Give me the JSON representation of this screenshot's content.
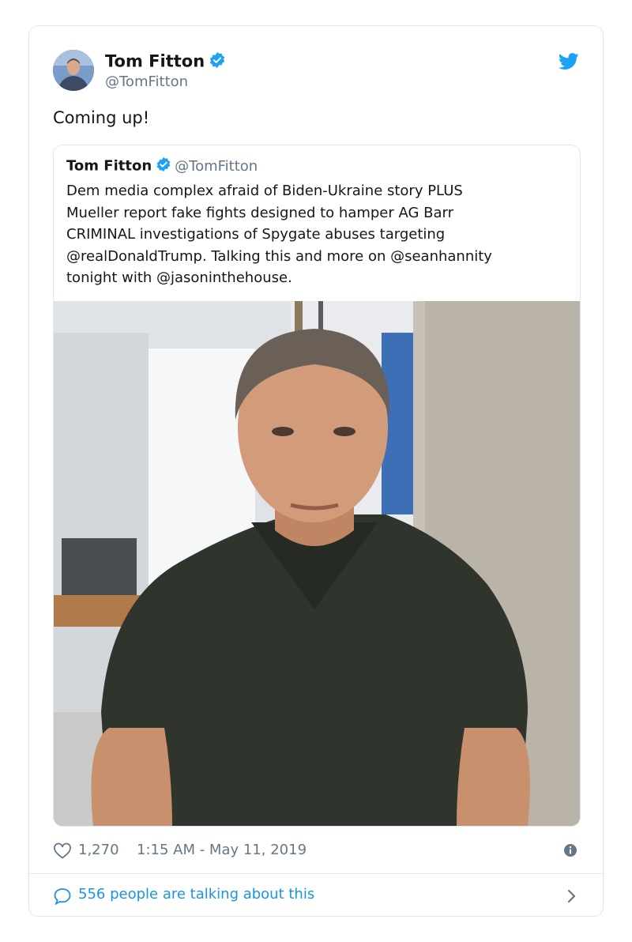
{
  "author": {
    "name": "Tom Fitton",
    "handle": "@TomFitton"
  },
  "tweet": {
    "text": "Coming up!"
  },
  "quoted": {
    "name": "Tom Fitton",
    "handle": "@TomFitton",
    "lines": [
      "Dem media complex afraid of Biden-Ukraine story PLUS",
      "Mueller report fake fights designed to hamper AG Barr",
      "CRIMINAL investigations of Spygate abuses targeting",
      "@realDonaldTrump. Talking this and more on @seanhannity",
      "tonight with @jasoninthehouse."
    ]
  },
  "meta": {
    "likes": "1,270",
    "timestamp": "1:15 AM - May 11, 2019"
  },
  "conversation": {
    "label": "556 people are talking about this"
  },
  "colors": {
    "accent": "#1da1f2",
    "link": "#1b95e0",
    "muted": "#657786",
    "border": "#e1e8ed"
  },
  "icons": [
    "verified-icon",
    "twitter-bird-icon",
    "heart-icon",
    "info-icon",
    "speech-bubble-icon",
    "chevron-right-icon"
  ]
}
